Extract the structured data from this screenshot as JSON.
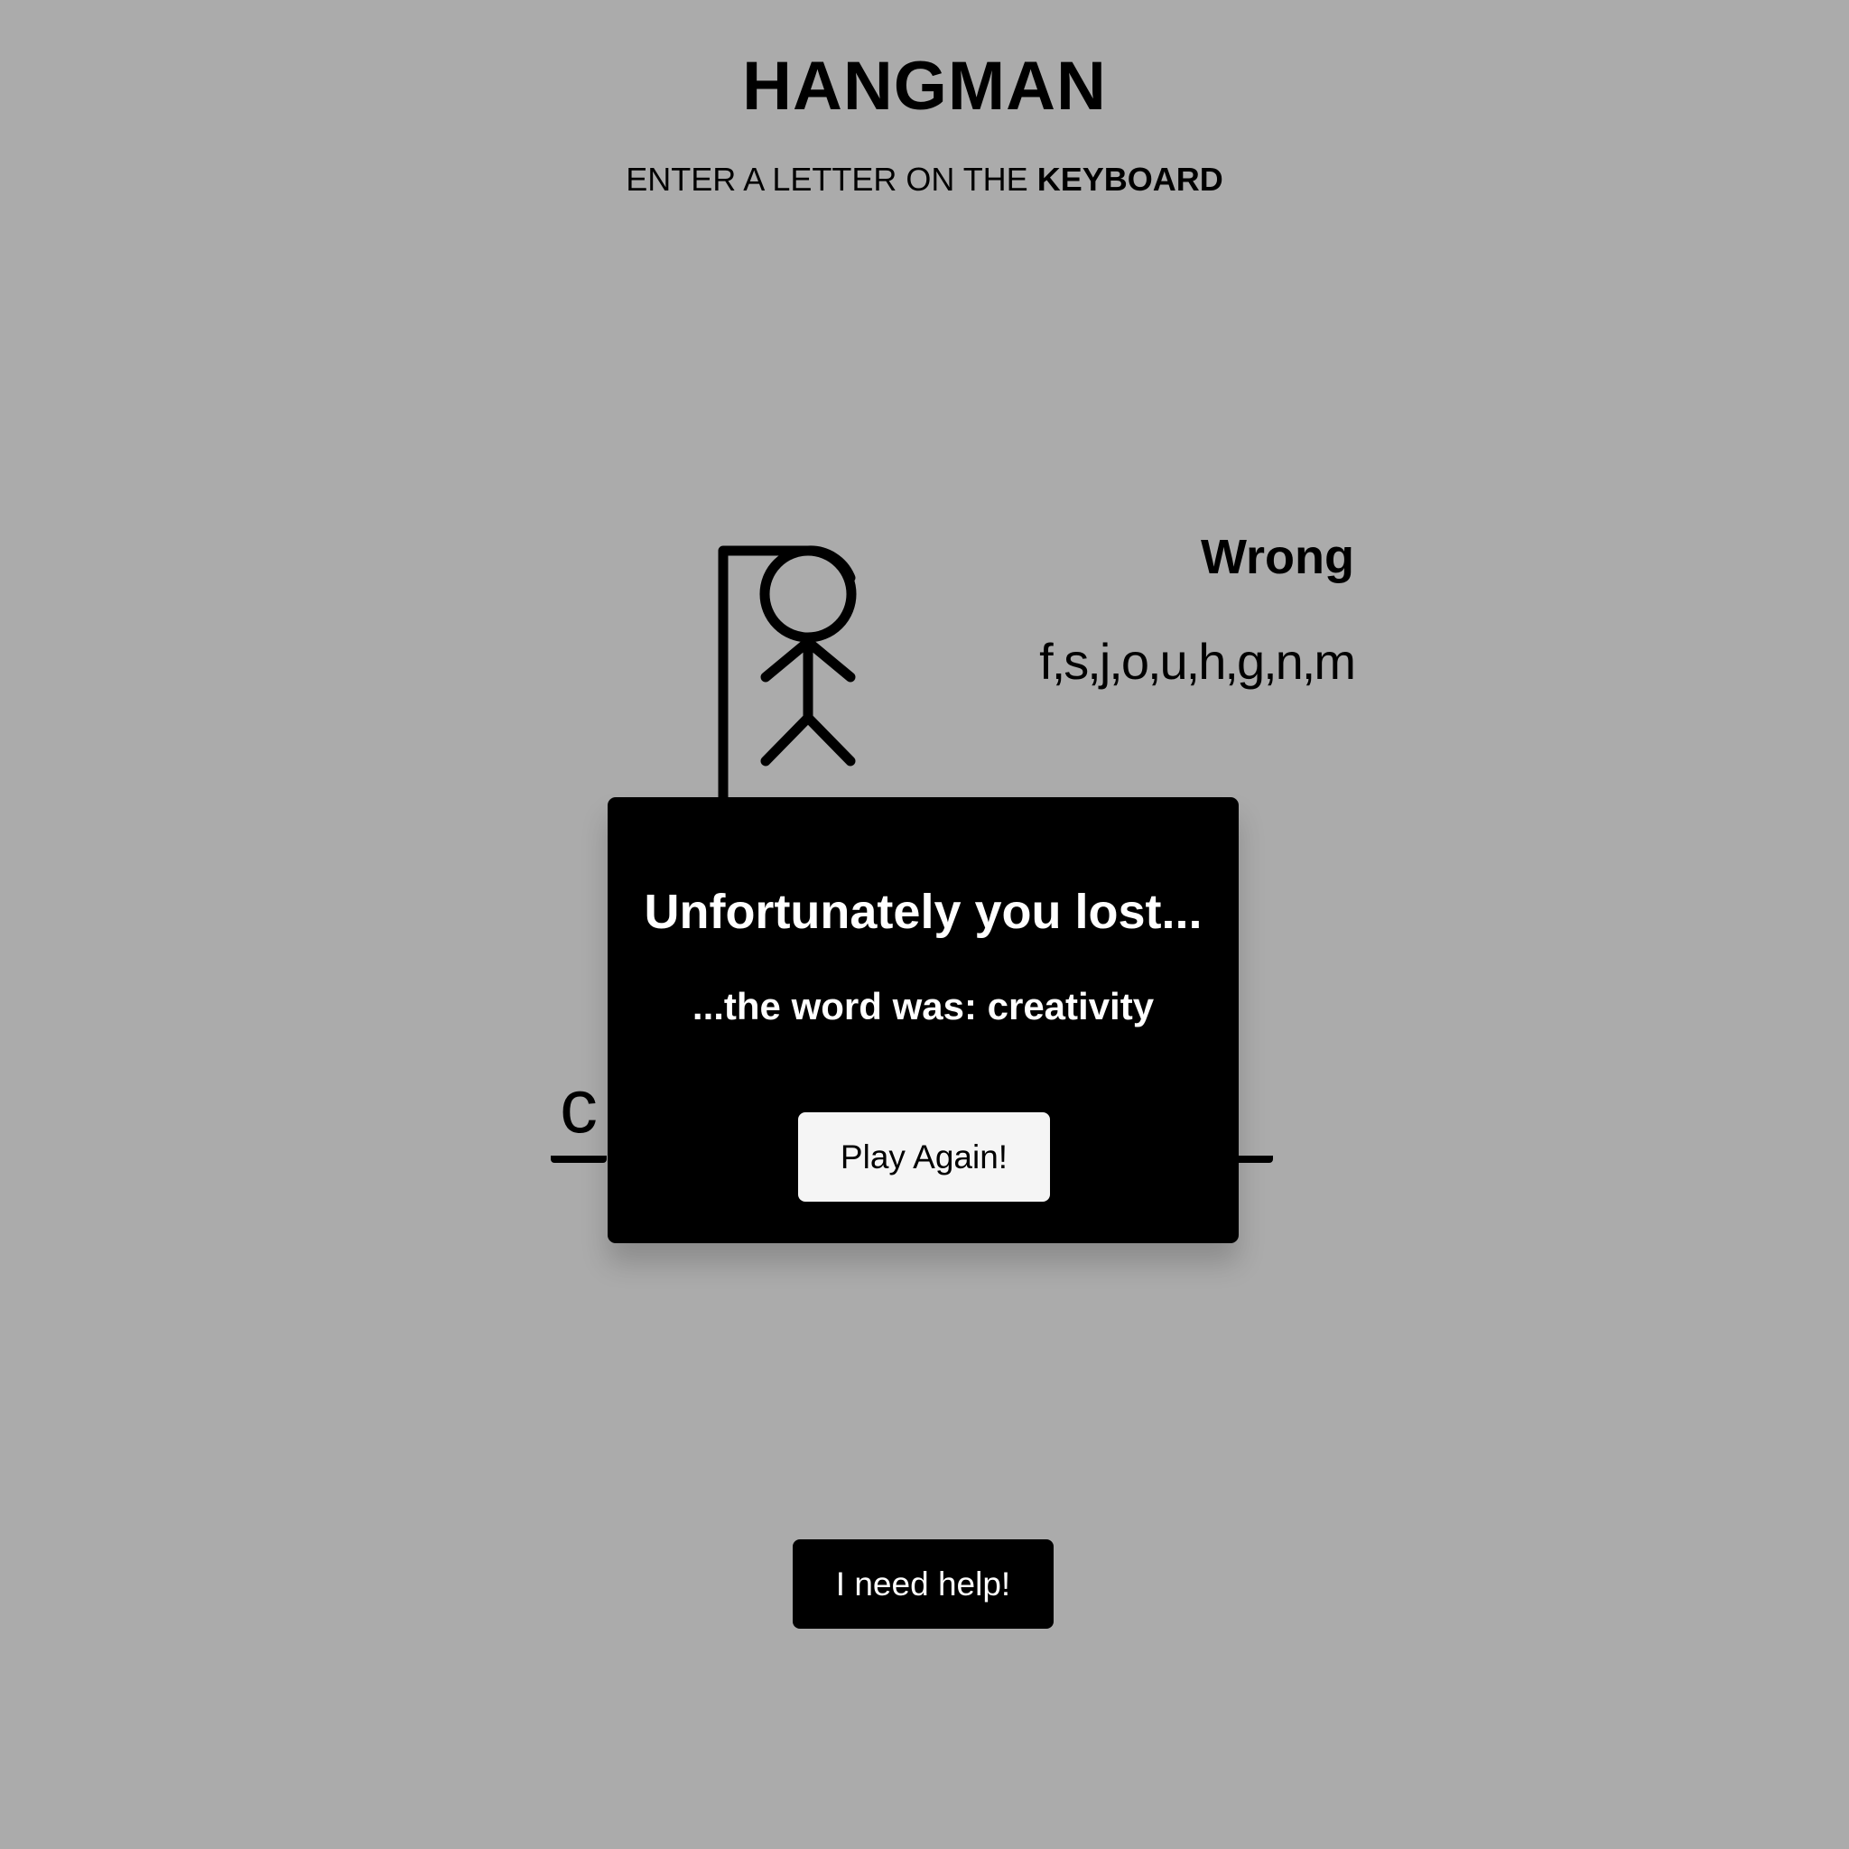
{
  "header": {
    "title": "HANGMAN",
    "instruction_prefix": "ENTER A LETTER ON THE ",
    "instruction_keyword": "KEYBOARD"
  },
  "wrong": {
    "label": "Wrong",
    "letters": "f,s,j,o,u,h,g,n,m"
  },
  "word": {
    "revealed": [
      "c",
      "",
      "",
      "",
      "",
      "",
      "",
      "",
      "",
      ""
    ]
  },
  "modal": {
    "title": "Unfortunately you lost...",
    "subtitle": "...the word was: creativity",
    "play_again_label": "Play Again!"
  },
  "help": {
    "label": "I need help!"
  },
  "colors": {
    "background": "#ababab",
    "modal": "#000000",
    "play_again_bg": "#f5f5f5",
    "help_bg": "#000000"
  },
  "icons": {
    "gallows": "gallows-icon",
    "figure": "hangman-figure-icon"
  }
}
